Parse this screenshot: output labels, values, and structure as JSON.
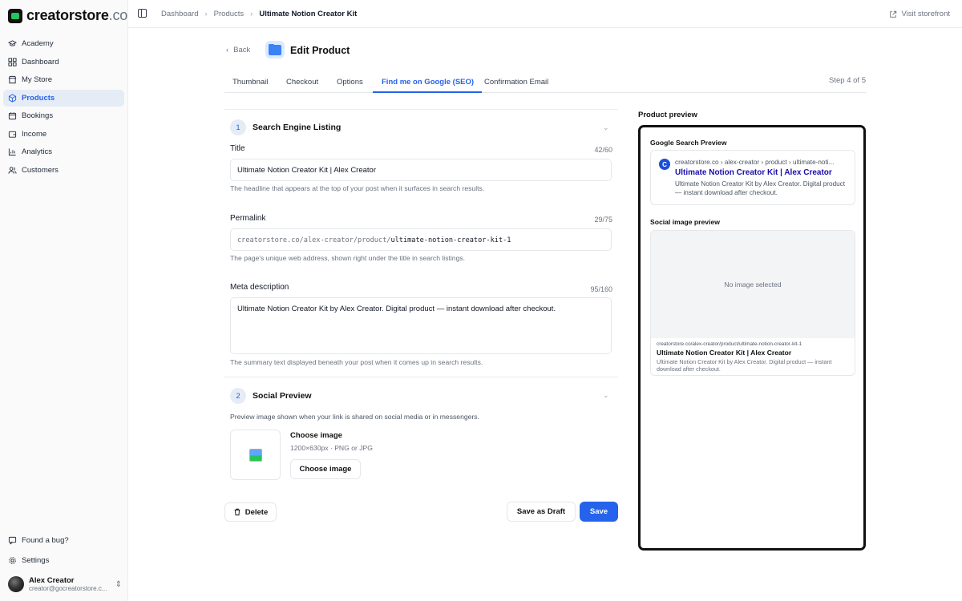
{
  "brand": {
    "name": "creatorstore",
    "tld": ".co"
  },
  "sidebar": {
    "items": [
      {
        "label": "Academy",
        "icon": "graduation-cap-icon"
      },
      {
        "label": "Dashboard",
        "icon": "grid-icon"
      },
      {
        "label": "My Store",
        "icon": "store-icon"
      },
      {
        "label": "Products",
        "icon": "box-icon",
        "active": true
      },
      {
        "label": "Bookings",
        "icon": "calendar-icon"
      },
      {
        "label": "Income",
        "icon": "wallet-icon"
      },
      {
        "label": "Analytics",
        "icon": "chart-icon"
      },
      {
        "label": "Customers",
        "icon": "users-icon"
      }
    ],
    "bug_label": "Found a bug?",
    "settings_label": "Settings",
    "user": {
      "name": "Alex Creator",
      "email": "creator@gocreatorstore.c..."
    }
  },
  "topbar": {
    "breadcrumbs": [
      "Dashboard",
      "Products",
      "Ultimate Notion Creator Kit"
    ],
    "visit_label": "Visit storefront"
  },
  "header": {
    "back_label": "Back",
    "title": "Edit Product"
  },
  "tabs": {
    "items": [
      "Thumbnail",
      "Checkout",
      "Options",
      "Find me on Google (SEO)",
      "Confirmation Email"
    ],
    "active_index": 3,
    "step": "Step 4 of 5"
  },
  "seo": {
    "num": "1",
    "title": "Search Engine Listing",
    "fields": {
      "title": {
        "label": "Title",
        "count": "42/60",
        "value": "Ultimate Notion Creator Kit | Alex Creator",
        "help": "The headline that appears at the top of your post when it surfaces in search results."
      },
      "permalink": {
        "label": "Permalink",
        "count": "29/75",
        "prefix": "creatorstore.co/alex-creator/product/",
        "slug": "ultimate-notion-creator-kit-1",
        "help": "The page's unique web address, shown right under the title in search listings."
      },
      "meta": {
        "label": "Meta description",
        "count": "95/160",
        "value": "Ultimate Notion Creator Kit by Alex Creator. Digital product — instant download after checkout.",
        "help": "The summary text displayed beneath your post when it comes up in search results."
      }
    }
  },
  "social": {
    "num": "2",
    "title": "Social Preview",
    "desc": "Preview image shown when your link is shared on social media or in messengers.",
    "choose_title": "Choose image",
    "choose_sub": "1200×630px · PNG or JPG",
    "choose_button": "Choose image"
  },
  "actions": {
    "delete": "Delete",
    "draft": "Save as Draft",
    "save": "Save"
  },
  "preview": {
    "label": "Product preview",
    "google_heading": "Google Search Preview",
    "favicon_letter": "C",
    "google_url": "creatorstore.co › alex-creator › product › ultimate-noti...",
    "google_title": "Ultimate Notion Creator Kit | Alex Creator",
    "google_desc": "Ultimate Notion Creator Kit by Alex Creator. Digital product — instant download after checkout.",
    "social_heading": "Social image preview",
    "no_image": "No image selected",
    "social_url": "creatorstore.co/alex-creator/product/ultimate-notion-creator-kit-1",
    "social_title": "Ultimate Notion Creator Kit | Alex Creator",
    "social_desc": "Ultimate Notion Creator Kit by Alex Creator. Digital product — instant download after checkout."
  },
  "colors": {
    "accent": "#2563eb",
    "google_title": "#1a0dab"
  }
}
